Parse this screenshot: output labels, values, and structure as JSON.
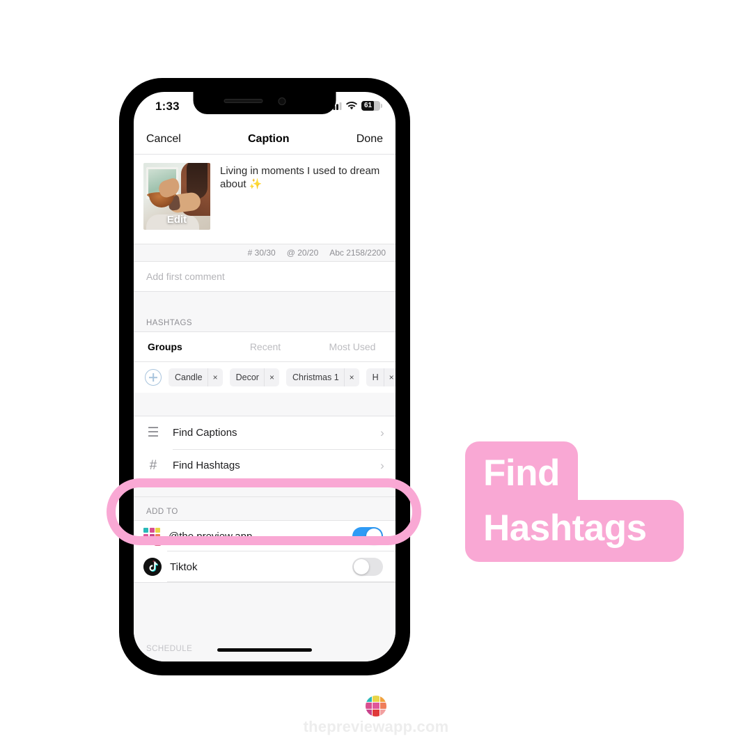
{
  "statusbar": {
    "time": "1:33",
    "battery_percent": "61",
    "signal_icon": "cellular-signal-icon",
    "wifi_icon": "wifi-icon",
    "battery_icon": "battery-icon"
  },
  "navbar": {
    "cancel": "Cancel",
    "title": "Caption",
    "done": "Done"
  },
  "composer": {
    "thumbnail_overlay": "Edit",
    "caption_text": "Living in moments I used to dream about ✨"
  },
  "counters": {
    "hashtags": "# 30/30",
    "mentions": "@ 20/20",
    "characters": "Abc 2158/2200"
  },
  "first_comment": {
    "placeholder": "Add first comment"
  },
  "hashtags_section": {
    "header": "HASHTAGS",
    "tabs": [
      {
        "label": "Groups",
        "active": true
      },
      {
        "label": "Recent",
        "active": false
      },
      {
        "label": "Most Used",
        "active": false
      }
    ],
    "add_group_icon": "plus-circle-icon",
    "chips": [
      {
        "label": "Candle",
        "remove": "×"
      },
      {
        "label": "Decor",
        "remove": "×"
      },
      {
        "label": "Christmas 1",
        "remove": "×"
      },
      {
        "label": "H",
        "remove": "×"
      }
    ]
  },
  "actions": [
    {
      "icon": "lines-icon",
      "label": "Find Captions",
      "chevron": "›"
    },
    {
      "icon": "hash-icon",
      "label": "Find Hashtags",
      "chevron": "›"
    }
  ],
  "add_to": {
    "header": "ADD TO",
    "rows": [
      {
        "icon": "preview-app-icon",
        "label": "@the.preview.app",
        "toggle": "on"
      },
      {
        "icon": "tiktok-icon",
        "label": "Tiktok",
        "toggle": "off"
      }
    ]
  },
  "schedule": {
    "header": "SCHEDULE"
  },
  "callout": {
    "line1": "Find",
    "line2": "Hashtags",
    "color": "#f9a8d4"
  },
  "watermark": {
    "text": "thepreviewapp.com",
    "logo_icon": "preview-app-logo-icon"
  },
  "colors": {
    "accent_pink": "#f9a8d4",
    "toggle_on": "#2f9bf5",
    "phone_frame": "#000000",
    "section_bg": "#f7f7f8"
  }
}
